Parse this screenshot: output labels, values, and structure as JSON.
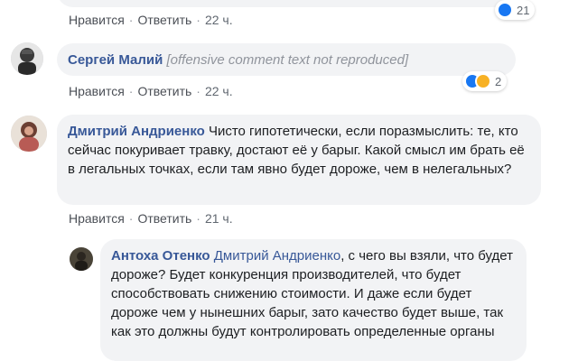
{
  "comments": [
    {
      "author": "",
      "text": "",
      "actions": {
        "like": "Нравится",
        "reply": "Ответить",
        "time": "22 ч."
      },
      "reactions": {
        "count": "21",
        "types": [
          "like"
        ]
      }
    },
    {
      "author": "Сергей Малий",
      "text": "[offensive comment text not reproduced]",
      "actions": {
        "like": "Нравится",
        "reply": "Ответить",
        "time": "22 ч."
      },
      "reactions": {
        "count": "2",
        "types": [
          "like",
          "haha"
        ]
      }
    },
    {
      "author": "Дмитрий Андриенко",
      "text": "Чисто гипотетически, если поразмыслить: те, кто сейчас покуривает травку, достают её у барыг. Какой смысл им брать её в легальных точках, если там явно будет дороже, чем в нелегальных?",
      "actions": {
        "like": "Нравится",
        "reply": "Ответить",
        "time": "21 ч."
      }
    },
    {
      "author": "Антоха Отенко",
      "mention": "Дмитрий Андриенко",
      "text": ", с чего вы взяли, что будет дороже? Будет конкуренция производителей, что будет способствовать снижению стоимости. И даже если будет дороже чем у нынешних барыг, зато качество будет выше, так как это должны будут контролировать определенные органы"
    }
  ],
  "colors": {
    "author_link": "#385898",
    "bubble_bg": "#f2f3f5",
    "meta_text": "#606770",
    "like_blue": "#1877f2",
    "haha_yellow": "#f7b125"
  }
}
